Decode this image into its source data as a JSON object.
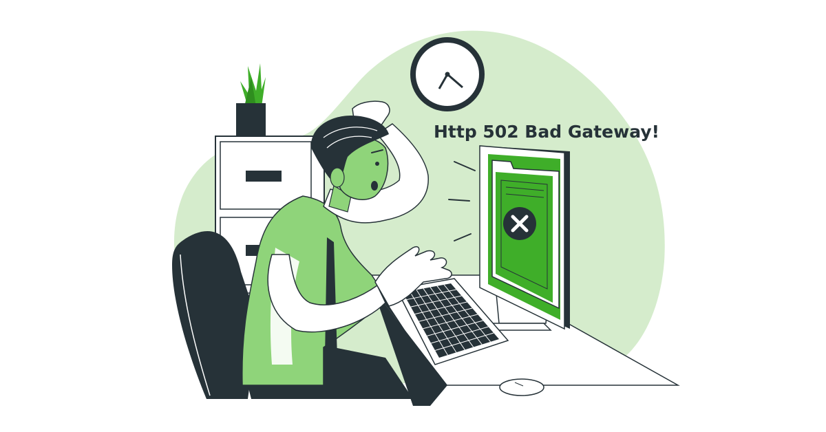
{
  "headline": "Http 502 Bad Gateway!",
  "colors": {
    "accent": "#3fae29",
    "accent_light": "#8fd47a",
    "blob": "#d5eccc",
    "ink": "#263238",
    "white": "#ffffff"
  },
  "icons": {
    "clock": "clock-icon",
    "error": "close-circle-icon",
    "plant": "potted-plant-icon",
    "folder": "folder-icon"
  }
}
